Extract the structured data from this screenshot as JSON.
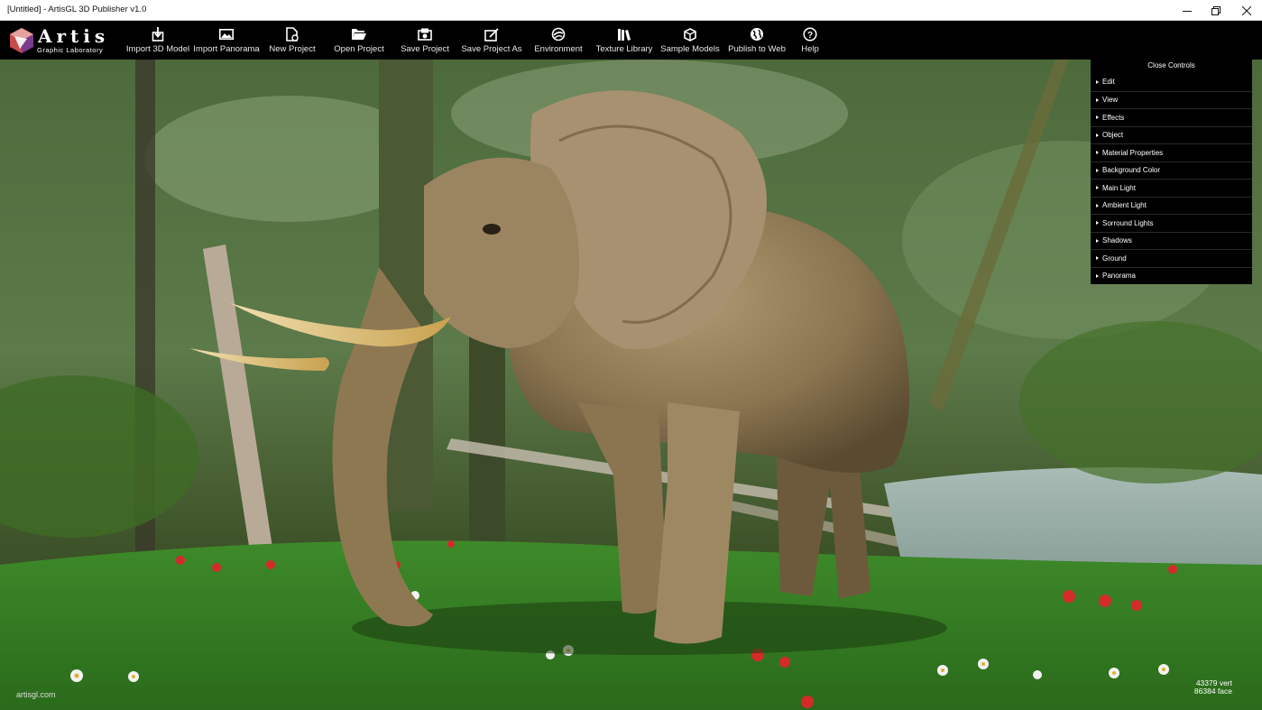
{
  "window": {
    "title": "[Untitled] - ArtisGL 3D Publisher v1.0",
    "controls": [
      "minimize-icon",
      "restore-icon",
      "close-icon"
    ]
  },
  "logo": {
    "word": "Artis",
    "subtitle": "Graphic Laboratory"
  },
  "toolbar": {
    "items": [
      {
        "label": "Import 3D Model",
        "icon": "import-model-icon"
      },
      {
        "label": "Import Panorama",
        "icon": "image-icon"
      },
      {
        "label": "New Project",
        "icon": "new-file-icon"
      },
      {
        "label": "Open Project",
        "icon": "folder-open-icon"
      },
      {
        "label": "Save Project",
        "icon": "save-icon"
      },
      {
        "label": "Save Project As",
        "icon": "save-as-icon"
      },
      {
        "label": "Environment",
        "icon": "environment-icon"
      },
      {
        "label": "Texture Library",
        "icon": "books-icon"
      },
      {
        "label": "Sample Models",
        "icon": "cubes-icon"
      },
      {
        "label": "Publish to Web",
        "icon": "globe-icon"
      },
      {
        "label": "Help",
        "icon": "help-icon"
      }
    ]
  },
  "panel": {
    "close_label": "Close Controls",
    "items": [
      "Edit",
      "View",
      "Effects",
      "Object",
      "Material Properties",
      "Background Color",
      "Main Light",
      "Ambient Light",
      "Sorround Lights",
      "Shadows",
      "Ground",
      "Panorama"
    ]
  },
  "footer": {
    "link": "artisgl.com",
    "stats": [
      "43379 vert",
      "86384 face"
    ]
  }
}
